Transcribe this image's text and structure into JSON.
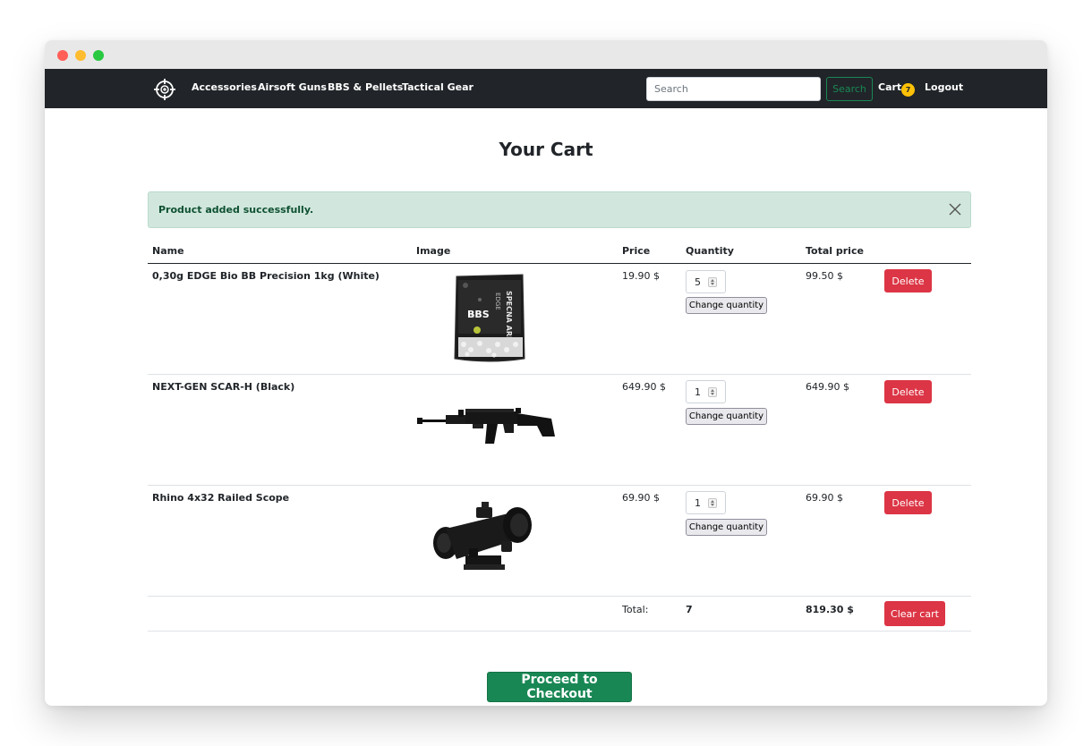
{
  "window": {
    "controls": [
      "close",
      "minimize",
      "zoom"
    ]
  },
  "navbar": {
    "brand_icon": "crosshair-icon",
    "links": [
      "Accessories",
      "Airsoft Guns",
      "BBS & Pellets",
      "Tactical Gear"
    ],
    "search": {
      "placeholder": "Search",
      "button_label": "Search"
    },
    "cart": {
      "label": "Cart",
      "count": "7"
    },
    "logout_label": "Logout"
  },
  "page": {
    "title": "Your Cart"
  },
  "alert": {
    "message": "Product added successfully.",
    "close_icon": "close-icon"
  },
  "table": {
    "headers": {
      "name": "Name",
      "image": "Image",
      "price": "Price",
      "quantity": "Quantity",
      "total_price": "Total price"
    },
    "rows": [
      {
        "name": "0,30g EDGE Bio BB Precision 1kg (White)",
        "image_icon": "bb-pellets-bag-image",
        "price": "19.90 $",
        "quantity": "5",
        "change_label": "Change quantity",
        "total": "99.50 $",
        "delete_label": "Delete"
      },
      {
        "name": "NEXT-GEN SCAR-H (Black)",
        "image_icon": "rifle-image",
        "price": "649.90 $",
        "quantity": "1",
        "change_label": "Change quantity",
        "total": "649.90 $",
        "delete_label": "Delete"
      },
      {
        "name": "Rhino 4x32 Railed Scope",
        "image_icon": "scope-image",
        "price": "69.90 $",
        "quantity": "1",
        "change_label": "Change quantity",
        "total": "69.90 $",
        "delete_label": "Delete"
      }
    ],
    "footer": {
      "label": "Total:",
      "quantity": "7",
      "total": "819.30 $",
      "clear_label": "Clear cart"
    }
  },
  "checkout_label": "Proceed to Checkout",
  "bag_text": {
    "brand": "SPECNA ARMS",
    "product": "BBS",
    "line": "EDGE"
  },
  "colors": {
    "navbar": "#212529",
    "success": "#198754",
    "danger": "#dc3545",
    "alert_bg": "#d1e7dd",
    "badge": "#ffc107"
  }
}
